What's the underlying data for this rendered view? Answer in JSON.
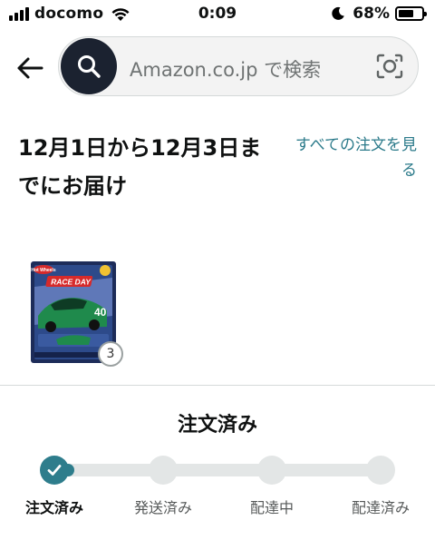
{
  "status_bar": {
    "carrier": "docomo",
    "time": "0:09",
    "battery_percent": "68%",
    "battery_level": 0.68,
    "icons": [
      "signal-icon",
      "wifi-icon",
      "moon-icon",
      "battery-icon"
    ]
  },
  "header": {
    "search_placeholder": "Amazon.co.jp で検索",
    "icons": [
      "back-arrow-icon",
      "search-icon",
      "camera-icon"
    ]
  },
  "delivery": {
    "title": "12月1日から12月3日までにお届け",
    "all_orders_link": "すべての注文を見る"
  },
  "product": {
    "box_brand": "Hot Wheels",
    "box_label": "RACE DAY",
    "quantity": "3"
  },
  "order_status": {
    "heading": "注文済み",
    "progress_fraction": 0.06,
    "steps": [
      {
        "label": "注文済み",
        "done": true
      },
      {
        "label": "発送済み",
        "done": false
      },
      {
        "label": "配達中",
        "done": false
      },
      {
        "label": "配達済み",
        "done": false
      }
    ]
  },
  "colors": {
    "accent": "#2e7d8c",
    "link": "#2b7a8a",
    "search_button": "#1b2230"
  }
}
